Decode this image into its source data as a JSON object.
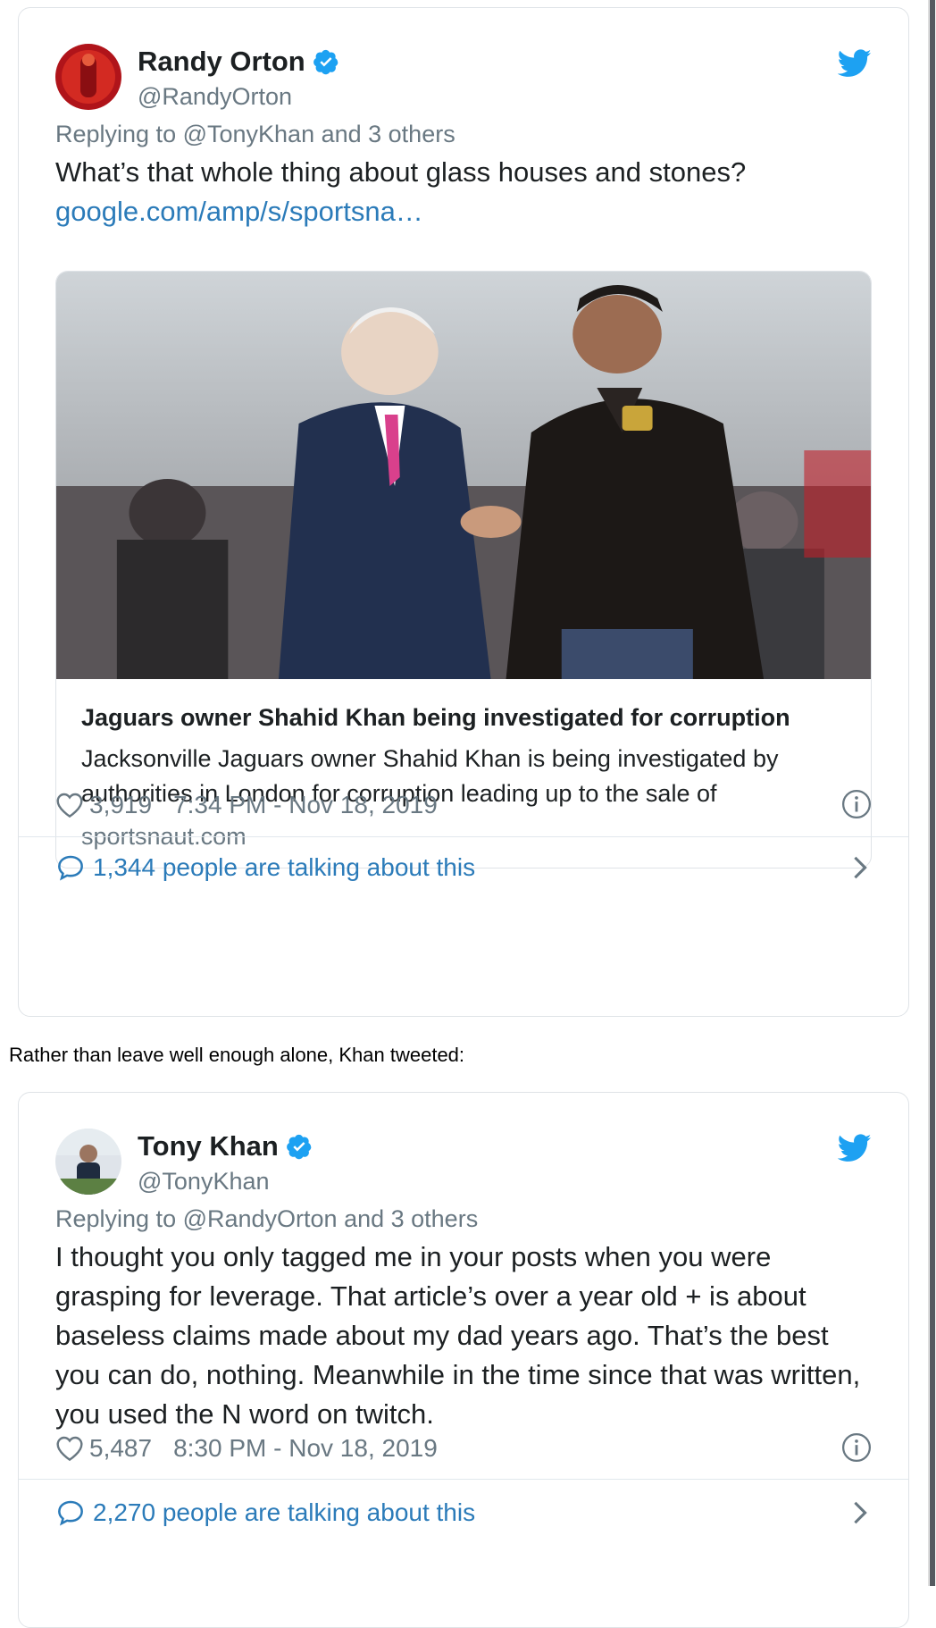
{
  "colors": {
    "accent": "#2b7bb9",
    "twitter_blue": "#1da1f2",
    "muted": "#697882",
    "text": "#1c2022",
    "border": "#dfe3e7"
  },
  "tweets": [
    {
      "display_name": "Randy Orton",
      "handle": "@RandyOrton",
      "verified_icon": "verified-badge-icon",
      "brand_icon": "twitter-bird-icon",
      "reply_prefix": "Replying to ",
      "reply_to": "@TonyKhan",
      "reply_suffix": " and 3 others",
      "text": "What’s that whole thing about glass houses and stones?",
      "link": "google.com/amp/s/sportsna…",
      "card": {
        "title": "Jaguars owner Shahid Khan being investigated for corruption",
        "description": "Jacksonville Jaguars owner Shahid Khan is being investigated by authorities in London for corruption leading up to the sale of",
        "domain": "sportsnaut.com"
      },
      "likes": "3,919",
      "timestamp": "7:34 PM - Nov 18, 2019",
      "talking": "1,344 people are talking about this"
    },
    {
      "display_name": "Tony Khan",
      "handle": "@TonyKhan",
      "verified_icon": "verified-badge-icon",
      "brand_icon": "twitter-bird-icon",
      "reply_prefix": "Replying to ",
      "reply_to": "@RandyOrton",
      "reply_suffix": " and 3 others",
      "text": "I thought you only tagged me in your posts when you were grasping for leverage. That article’s over a year old + is about baseless claims made about my dad years ago. That’s the best you can do, nothing. Meanwhile in the time since that was written, you used the N word on twitch.",
      "likes": "5,487",
      "timestamp": "8:30 PM - Nov 18, 2019",
      "talking": "2,270 people are talking about this"
    }
  ],
  "between_text": "Rather than leave well enough alone, Khan tweeted:"
}
